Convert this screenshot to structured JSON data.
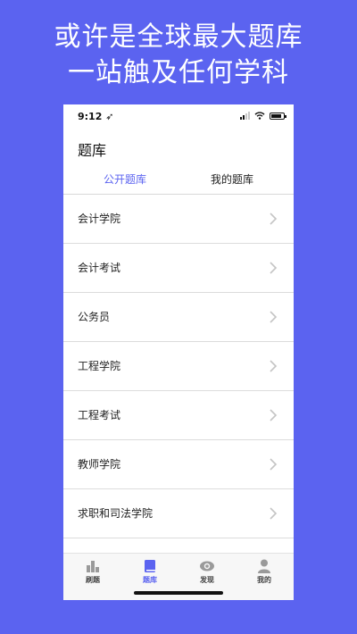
{
  "headline": {
    "line1": "或许是全球最大题库",
    "line2": "一站触及任何学科"
  },
  "status_bar": {
    "time": "9:12 ➶"
  },
  "page": {
    "title": "题库"
  },
  "tabs": [
    {
      "label": "公开题库",
      "active": true
    },
    {
      "label": "我的题库",
      "active": false
    }
  ],
  "list": [
    {
      "label": "会计学院"
    },
    {
      "label": "会计考试"
    },
    {
      "label": "公务员"
    },
    {
      "label": "工程学院"
    },
    {
      "label": "工程考试"
    },
    {
      "label": "教师学院"
    },
    {
      "label": "求职和司法学院"
    }
  ],
  "tabbar": [
    {
      "label": "刷题",
      "icon": "bar-chart-icon",
      "active": false
    },
    {
      "label": "题库",
      "icon": "book-icon",
      "active": true
    },
    {
      "label": "发现",
      "icon": "eye-icon",
      "active": false
    },
    {
      "label": "我的",
      "icon": "person-icon",
      "active": false
    }
  ],
  "colors": {
    "background": "#5b63f0",
    "accent": "#5b63f0",
    "inactive_icon": "#9a9a9a"
  }
}
